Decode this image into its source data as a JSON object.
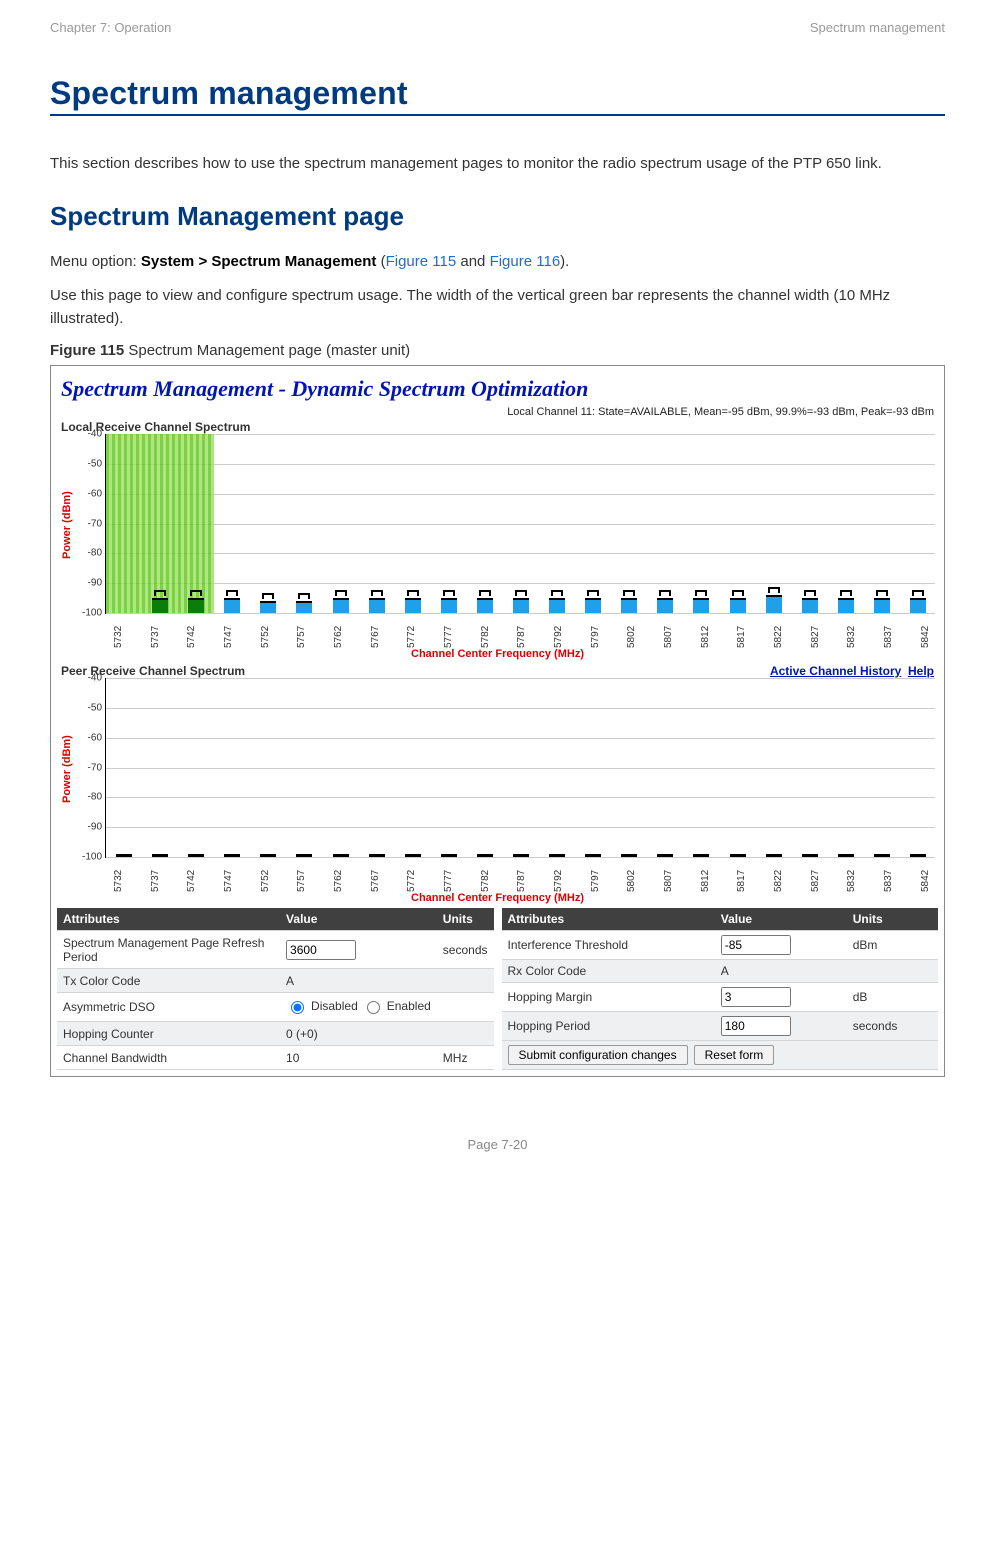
{
  "header": {
    "left": "Chapter 7:  Operation",
    "right": "Spectrum management"
  },
  "section_title": "Spectrum management",
  "intro": "This section describes how to use the spectrum management pages to monitor the radio spectrum usage of the PTP 650 link.",
  "sub_title": "Spectrum Management page",
  "menu_line_prefix": "Menu option: ",
  "menu_line_bold": "System > Spectrum Management",
  "menu_line_suffix1": " (",
  "menu_fig1": "Figure 115",
  "menu_line_and": " and ",
  "menu_fig2": "Figure 116",
  "menu_line_suffix2": ").",
  "usage_text": "Use this page to view and configure spectrum usage. The width of the vertical green bar represents the channel width (10 MHz illustrated).",
  "fig_caption_bold": "Figure 115",
  "fig_caption_rest": "  Spectrum Management page (master unit)",
  "screenshot": {
    "title": "Spectrum Management - Dynamic Spectrum Optimization",
    "status": "Local Channel 11: State=AVAILABLE, Mean=-95 dBm, 99.9%=-93 dBm, Peak=-93 dBm",
    "local_title": "Local Receive Channel Spectrum",
    "peer_title": "Peer Receive Channel Spectrum",
    "right_links": {
      "ach": "Active Channel History",
      "help": "Help"
    },
    "ylabel": "Power (dBm)",
    "xlabel": "Channel Center Frequency (MHz)"
  },
  "chart_data": [
    {
      "type": "bar",
      "title": "Local Receive Channel Spectrum",
      "ylabel": "Power (dBm)",
      "xlabel": "Channel Center Frequency (MHz)",
      "ylim": [
        -100,
        -40
      ],
      "yticks": [
        -40,
        -50,
        -60,
        -70,
        -80,
        -90,
        -100
      ],
      "active_band_center": 5737,
      "active_band_width_channels": 2,
      "categories": [
        5732,
        5737,
        5742,
        5747,
        5752,
        5757,
        5762,
        5767,
        5772,
        5777,
        5782,
        5787,
        5792,
        5797,
        5802,
        5807,
        5812,
        5817,
        5822,
        5827,
        5832,
        5837,
        5842
      ],
      "mean_values": [
        null,
        -95,
        -95,
        -95,
        -96,
        -96,
        -95,
        -95,
        -95,
        -95,
        -95,
        -95,
        -95,
        -95,
        -95,
        -95,
        -95,
        -95,
        -94,
        -95,
        -95,
        -95,
        -95
      ],
      "peak_values": [
        null,
        -93,
        -93,
        -93,
        -94,
        -94,
        -93,
        -93,
        -93,
        -93,
        -93,
        -93,
        -93,
        -93,
        -93,
        -93,
        -93,
        -93,
        -92,
        -93,
        -93,
        -93,
        -93
      ],
      "bar_colors": [
        null,
        "green",
        "green",
        "blue",
        "blue",
        "blue",
        "blue",
        "blue",
        "blue",
        "blue",
        "blue",
        "blue",
        "blue",
        "blue",
        "blue",
        "blue",
        "blue",
        "blue",
        "blue",
        "blue",
        "blue",
        "blue",
        "blue"
      ]
    },
    {
      "type": "bar",
      "title": "Peer Receive Channel Spectrum",
      "ylabel": "Power (dBm)",
      "xlabel": "Channel Center Frequency (MHz)",
      "ylim": [
        -100,
        -40
      ],
      "yticks": [
        -40,
        -50,
        -60,
        -70,
        -80,
        -90,
        -100
      ],
      "categories": [
        5732,
        5737,
        5742,
        5747,
        5752,
        5757,
        5762,
        5767,
        5772,
        5777,
        5782,
        5787,
        5792,
        5797,
        5802,
        5807,
        5812,
        5817,
        5822,
        5827,
        5832,
        5837,
        5842
      ],
      "mean_values": [
        -99,
        -99,
        -99,
        -99,
        -99,
        -99,
        -99,
        -99,
        -99,
        -99,
        -99,
        -99,
        -99,
        -99,
        -99,
        -99,
        -99,
        -99,
        -99,
        -99,
        -99,
        -99,
        -99
      ]
    }
  ],
  "attrs_left": {
    "header": [
      "Attributes",
      "Value",
      "Units"
    ],
    "rows": [
      {
        "attr": "Spectrum Management Page Refresh Period",
        "val": "3600",
        "type": "text",
        "units": "seconds"
      },
      {
        "attr": "Tx Color Code",
        "val": "A",
        "type": "static",
        "units": ""
      },
      {
        "attr": "Asymmetric DSO",
        "val": "Disabled",
        "val2": "Enabled",
        "type": "radio",
        "units": ""
      },
      {
        "attr": "Hopping Counter",
        "val": "0 (+0)",
        "type": "static",
        "units": ""
      },
      {
        "attr": "Channel Bandwidth",
        "val": "10",
        "type": "static",
        "units": "MHz"
      }
    ]
  },
  "attrs_right": {
    "header": [
      "Attributes",
      "Value",
      "Units"
    ],
    "rows": [
      {
        "attr": "Interference Threshold",
        "val": "-85",
        "type": "text",
        "units": "dBm"
      },
      {
        "attr": "Rx Color Code",
        "val": "A",
        "type": "static",
        "units": ""
      },
      {
        "attr": "Hopping Margin",
        "val": "3",
        "type": "text",
        "units": "dB"
      },
      {
        "attr": "Hopping Period",
        "val": "180",
        "type": "text",
        "units": "seconds"
      }
    ],
    "buttons": {
      "submit": "Submit configuration changes",
      "reset": "Reset form"
    }
  },
  "footer_prefix": "Page ",
  "footer_page": "7-20"
}
